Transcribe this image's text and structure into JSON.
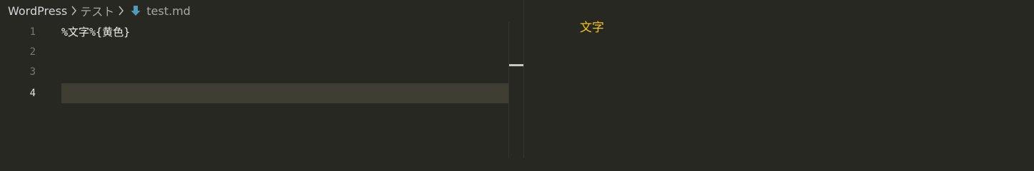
{
  "breadcrumb": {
    "items": [
      {
        "label": "WordPress"
      },
      {
        "label": "テスト"
      }
    ],
    "file": {
      "label": "test.md",
      "icon": "markdown-file-icon"
    }
  },
  "editor": {
    "lines": [
      {
        "number": "1",
        "text": "%文字%{黄色}"
      },
      {
        "number": "2",
        "text": ""
      },
      {
        "number": "3",
        "text": ""
      },
      {
        "number": "4",
        "text": ""
      }
    ],
    "active_line": 4
  },
  "preview": {
    "text": "文字",
    "text_color": "#f0c419"
  },
  "colors": {
    "background": "#272822",
    "current_line": "#3e3d32",
    "md_icon": "#519aba"
  }
}
